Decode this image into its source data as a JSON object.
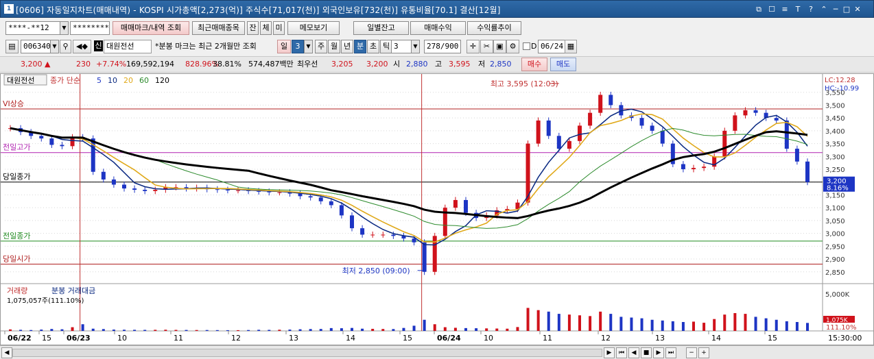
{
  "window": {
    "title": "[0606] 자동일지차트(매매내역) - KOSPI 시가총액[2,273(억)] 주식수[71,017(천)] 외국인보유[732(천)] 유통비율[70.1] 결산[12월]",
    "app_icon": "1",
    "buttons": [
      "restore-icon",
      "tile-icon",
      "menu-icon",
      "font-icon",
      "help-icon",
      "pin-icon",
      "minimize-icon",
      "maximize-icon",
      "close-icon"
    ],
    "button_glyphs": [
      "⧉",
      "☐",
      "≡",
      "T",
      "?",
      "⌃",
      "─",
      "□",
      "✕"
    ]
  },
  "toolbar1": {
    "account": "****-**12",
    "password": "*********",
    "btn_trade_mark": "매매마크/내역 조회",
    "btn_recent": "최근매매종목",
    "btn_jan": "잔",
    "btn_che": "체",
    "btn_mi": "미",
    "btn_memo": "메모보기",
    "btn_daily_balance": "일별잔고",
    "btn_trade_profit": "매매수익",
    "btn_return_trend": "수익률추이"
  },
  "toolbar2": {
    "code": "006340",
    "stock_badge": "신",
    "stock_name": "대원전선",
    "notice": "*분봉 마크는 최근 2개월만 조회",
    "period_label": "일",
    "period_value": "3",
    "tabs": [
      "주",
      "월",
      "년",
      "분",
      "초",
      "틱"
    ],
    "active_tab": "분",
    "interval": "3",
    "count": "278/900",
    "date_check_label": "D",
    "date": "06/24"
  },
  "quote": {
    "price": "3,200",
    "arrow": "▲",
    "change": "230",
    "change_pct": "+7.74%",
    "volume": "169,592,194",
    "vol_ratio": "828.96%",
    "turnover": "38.81%",
    "amount": "574,487백만",
    "best_ask_label": "최우선",
    "best_ask": "3,205",
    "best_bid": "3,200",
    "open_label": "시",
    "open": "2,880",
    "high_label": "고",
    "high": "3,595",
    "low_label": "저",
    "low": "2,850",
    "buy_btn": "매수",
    "sell_btn": "매도"
  },
  "chart_header": {
    "stock": "대원전선",
    "ma_label": "종가 단순",
    "ma_periods": [
      "5",
      "10",
      "20",
      "60",
      "120"
    ],
    "lc": "LC:12.28",
    "hc": "HC:-10.99",
    "vol_label1": "거래량",
    "vol_label2": "분봉 거래대금",
    "vol_value": "1,075,057주(111.10%)"
  },
  "colors": {
    "up": "#d0121b",
    "down": "#1d35c4",
    "ma5": "#1d35c4",
    "ma10": "#0b2a80",
    "ma20": "#e0a91a",
    "ma60": "#2b8a2b",
    "ma120": "#000000"
  },
  "chart_data": {
    "type": "candlestick",
    "ylim": [
      2820,
      3600
    ],
    "y_ticks": [
      2850,
      2900,
      2950,
      3000,
      3050,
      3100,
      3150,
      3200,
      3250,
      3300,
      3350,
      3400,
      3450,
      3500,
      3550
    ],
    "y_tick_labels": [
      "2,850",
      "2,900",
      "2,950",
      "3,000",
      "3,050",
      "3,100",
      "3,150",
      "3,200",
      "3,250",
      "3,300",
      "3,350",
      "3,400",
      "3,450",
      "3,500",
      "3,550"
    ],
    "current_price_label": "3,200",
    "current_pct_label": "8.16%",
    "ref_lines": [
      {
        "label": "VI상승",
        "value": 3485,
        "color": "#b02020"
      },
      {
        "label": "전일고가",
        "value": 3315,
        "color": "#b020b0"
      },
      {
        "label": "당일종가",
        "value": 3200,
        "color": "#000000"
      },
      {
        "label": "전일종가",
        "value": 2970,
        "color": "#1f8a1f"
      },
      {
        "label": "당일시가",
        "value": 2880,
        "color": "#b02020"
      }
    ],
    "annotations": [
      {
        "text": "최고 3,595 (12:03)",
        "value": 3595
      },
      {
        "text": "최저 2,850 (09:00)",
        "value": 2850
      }
    ],
    "x_labels": [
      "06/22",
      "15",
      "06/23",
      "10",
      "11",
      "12",
      "13",
      "14",
      "15",
      "06/24",
      "10",
      "11",
      "12",
      "13",
      "14",
      "15"
    ],
    "bold_x_labels": [
      "06/22",
      "06/23",
      "06/24"
    ],
    "close_path": [
      3410,
      3395,
      3380,
      3370,
      3345,
      3340,
      3375,
      3370,
      3240,
      3210,
      3190,
      3175,
      3170,
      3165,
      3170,
      3180,
      3180,
      3175,
      3178,
      3172,
      3170,
      3168,
      3168,
      3165,
      3163,
      3160,
      3160,
      3155,
      3145,
      3140,
      3125,
      3110,
      3070,
      3020,
      2995,
      2995,
      2995,
      2990,
      2980,
      2965,
      2850,
      2990,
      3100,
      3130,
      3080,
      3060,
      3070,
      3090,
      3095,
      3120,
      3350,
      3440,
      3380,
      3330,
      3360,
      3420,
      3470,
      3540,
      3500,
      3460,
      3450,
      3420,
      3400,
      3350,
      3270,
      3250,
      3255,
      3260,
      3300,
      3400,
      3460,
      3480,
      3470,
      3450,
      3440,
      3330,
      3280,
      3200
    ],
    "volume_ylim": [
      0,
      6000
    ],
    "volume_tick_label": "5,000K",
    "volume_current_label": "1,075K",
    "volume_pct_label": "111.10%",
    "volumes": [
      200,
      150,
      120,
      180,
      260,
      220,
      500,
      900,
      300,
      250,
      180,
      160,
      150,
      140,
      150,
      160,
      140,
      130,
      120,
      120,
      110,
      100,
      100,
      120,
      150,
      140,
      160,
      180,
      220,
      250,
      260,
      380,
      360,
      400,
      300,
      280,
      260,
      250,
      400,
      700,
      1500,
      900,
      500,
      420,
      380,
      360,
      340,
      320,
      300,
      520,
      3100,
      2800,
      2600,
      2300,
      2200,
      2100,
      2000,
      2600,
      2300,
      1900,
      1800,
      1700,
      1500,
      1400,
      1300,
      1200,
      1250,
      1100,
      1600,
      2200,
      2400,
      2300,
      1900,
      1700,
      1500,
      1300,
      1200,
      1075
    ],
    "time_label": "15:30:00"
  },
  "footer": {
    "nav_glyphs": [
      "◀",
      "▶",
      "⏮",
      "◀",
      "■",
      "▶",
      "⏭",
      "−",
      "+"
    ],
    "nav_names": [
      "scroll-left-icon",
      "scroll-right-icon",
      "first-icon",
      "prev-icon",
      "stop-icon",
      "play-icon",
      "last-icon",
      "zoom-out-icon",
      "zoom-in-icon"
    ]
  }
}
